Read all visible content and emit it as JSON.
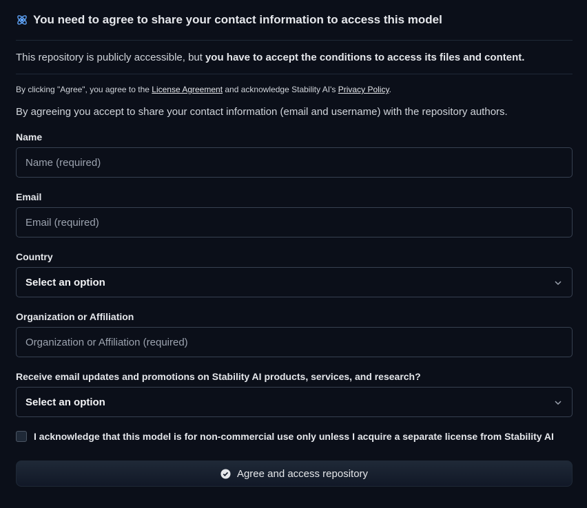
{
  "header": {
    "title": "You need to agree to share your contact information to access this model",
    "icon": "gated-model-icon"
  },
  "notice": {
    "prefix": "This repository is publicly accessible, but",
    "emphasis": "you have to accept the conditions to access its files and content."
  },
  "license": {
    "text_1": "By clicking \"Agree\", you agree to the ",
    "link_1": "License Agreement",
    "text_2": " and acknowledge Stability AI's ",
    "link_2": "Privacy Policy",
    "text_3": "."
  },
  "agree_text": "By agreeing you accept to share your contact information (email and username) with the repository authors.",
  "form": {
    "name": {
      "label": "Name",
      "placeholder": "Name (required)"
    },
    "email": {
      "label": "Email",
      "placeholder": "Email (required)"
    },
    "country": {
      "label": "Country",
      "value": "Select an option"
    },
    "organization": {
      "label": "Organization or Affiliation",
      "placeholder": "Organization or Affiliation (required)"
    },
    "updates": {
      "label": "Receive email updates and promotions on Stability AI products, services, and research?",
      "value": "Select an option"
    },
    "acknowledge": {
      "label": "I acknowledge that this model is for non-commercial use only unless I acquire a separate license from Stability AI",
      "checked": false
    }
  },
  "submit": {
    "label": "Agree and access repository",
    "icon": "check-circle-icon"
  },
  "colors": {
    "background": "#0b0f19",
    "border": "#374151",
    "accent": "#3b82f6"
  }
}
